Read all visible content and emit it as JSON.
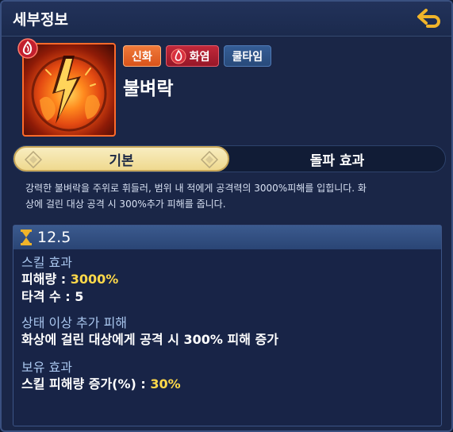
{
  "header": {
    "title": "세부정보",
    "back_icon": "back-arrow-icon"
  },
  "skill": {
    "name": "불벼락",
    "tags": {
      "myth": "신화",
      "element": "화염",
      "cooldown_type": "쿨타임"
    }
  },
  "tabs": {
    "basic": "기본",
    "breakthrough": "돌파 효과"
  },
  "description": {
    "line1": "강력한 불벼락을 주위로 휘들러, 범위 내 적에게 공격력의 3000%피해를 입힙니다. 화",
    "line2": "상에 걸린 대상 공격 시 300%추가 피해를 줍니다."
  },
  "details": {
    "cooldown": "12.5",
    "skill_effect": {
      "title": "스킬 효과",
      "damage_label": "피해량 : ",
      "damage_value": "3000%",
      "hits_label": "타격 수 : ",
      "hits_value": "5"
    },
    "status_bonus": {
      "title": "상태 이상 추가 피해",
      "text": "화상에 걸린 대상에게 공격 시 300% 피해 증가"
    },
    "passive": {
      "title": "보유 효과",
      "label": "스킬 피해량 증가(%) : ",
      "value": "30%"
    }
  },
  "colors": {
    "accent_gold": "#ffd94a",
    "myth_tag": "#e8652a",
    "fire_tag": "#ae2031",
    "cool_tag": "#2f5489"
  }
}
